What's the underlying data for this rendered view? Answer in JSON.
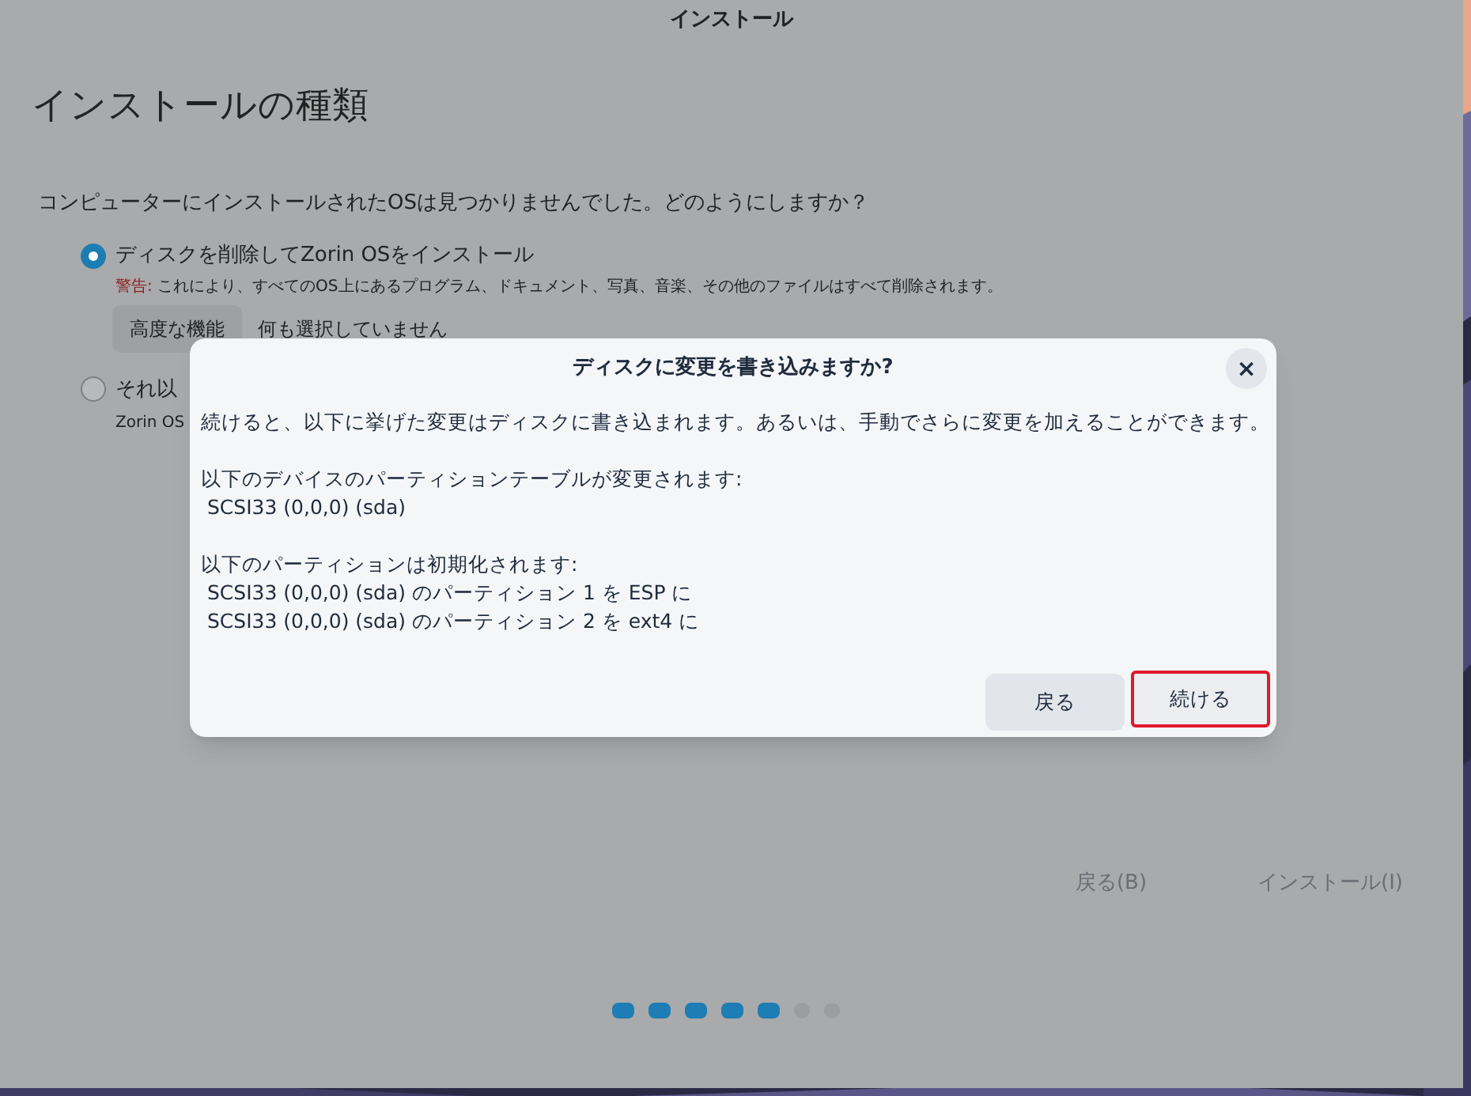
{
  "window": {
    "title": "インストール"
  },
  "page": {
    "heading": "インストールの種類",
    "question": "コンピューターにインストールされたOSは見つかりませんでした。どのようにしますか？",
    "options": [
      {
        "label": "ディスクを削除してZorin OSをインストール",
        "selected": true,
        "warning_label": "警告:",
        "warning": "これにより、すべてのOS上にあるプログラム、ドキュメント、写真、音楽、その他のファイルはすべて削除されます。",
        "button": "高度な機能",
        "button_note": "何も選択していません"
      },
      {
        "label": "それ以",
        "selected": false,
        "description": "Zorin OS"
      }
    ],
    "buttons": [
      {
        "label": "戻る(B)"
      },
      {
        "label": "インストール(I)"
      }
    ],
    "steps": [
      {
        "done": true
      },
      {
        "done": true
      },
      {
        "done": true
      },
      {
        "done": true
      },
      {
        "done": true
      },
      {
        "done": false
      },
      {
        "done": false
      }
    ]
  },
  "dialog": {
    "title": "ディスクに変更を書き込みますか?",
    "close": "×",
    "paragraphs": [
      [
        "続けると、以下に挙げた変更はディスクに書き込まれます。あるいは、手動でさらに変更を加えることができます。"
      ],
      [
        "以下のデバイスのパーティションテーブルが変更されます:",
        " SCSI33 (0,0,0) (sda)"
      ],
      [
        "以下のパーティションは初期化されます:",
        " SCSI33 (0,0,0) (sda) のパーティション 1 を ESP に",
        " SCSI33 (0,0,0) (sda) のパーティション 2 を ext4 に"
      ]
    ],
    "buttons": [
      {
        "label": "戻る",
        "highlighted": false
      },
      {
        "label": "続ける",
        "highlighted": true
      }
    ]
  }
}
